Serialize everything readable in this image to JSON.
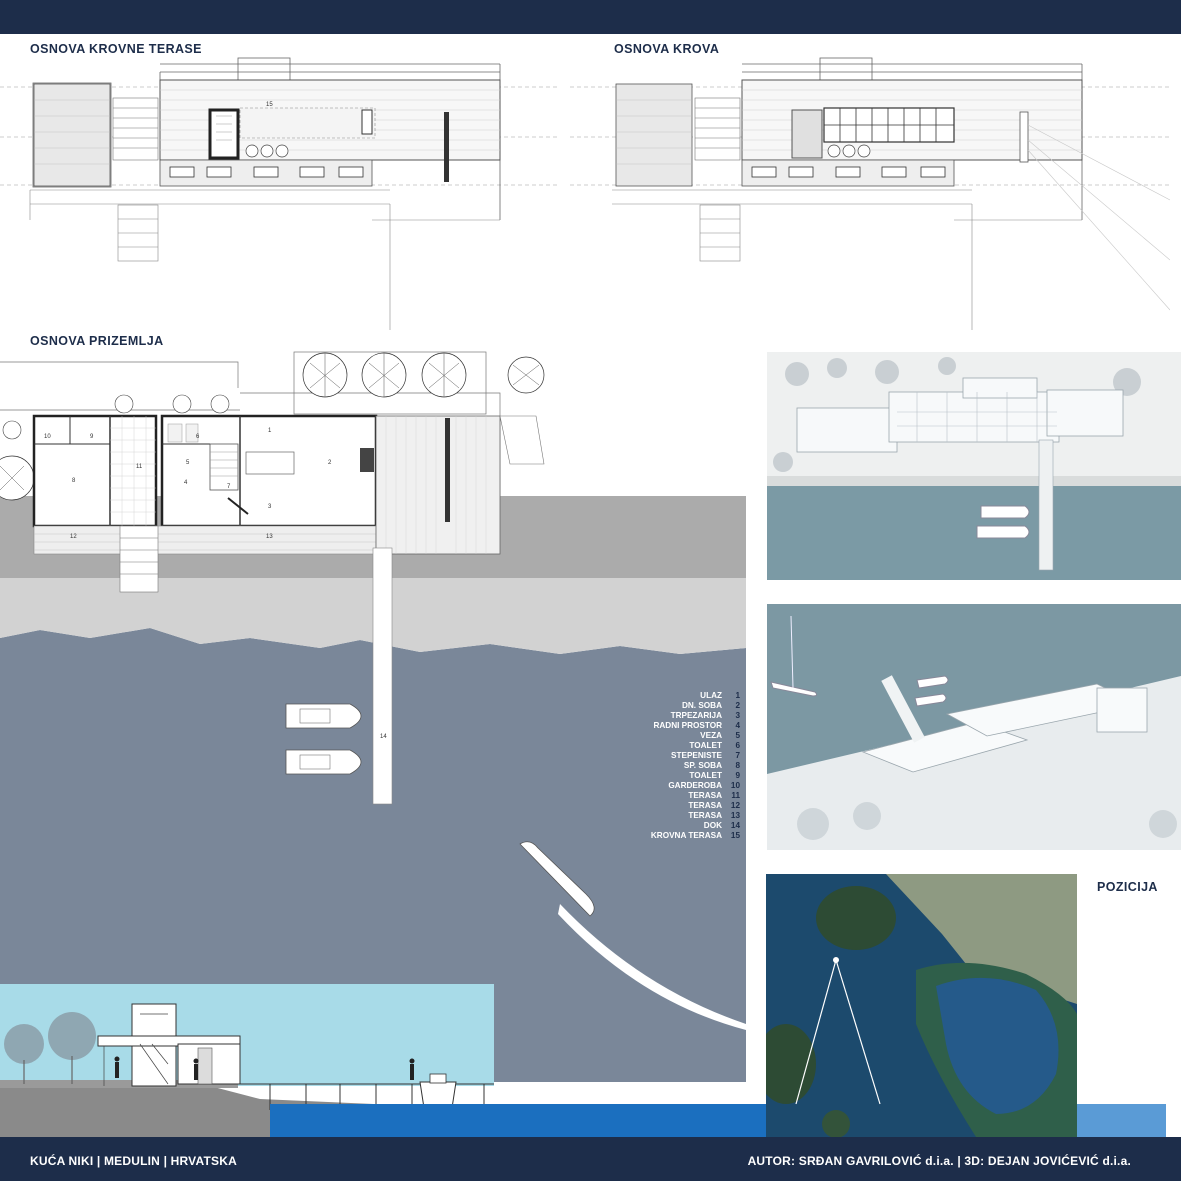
{
  "headings": {
    "roof_terrace_plan": "OSNOVA  KROVNE TERASE",
    "roof_plan": "OSNOVA  KROVA",
    "ground_floor_plan": "OSNOVA  PRIZEMLJA",
    "location": "POZICIJA"
  },
  "legend": [
    {
      "label": "ULAZ",
      "num": "1"
    },
    {
      "label": "DN. SOBA",
      "num": "2"
    },
    {
      "label": "TRPEZARIJA",
      "num": "3"
    },
    {
      "label": "RADNI PROSTOR",
      "num": "4"
    },
    {
      "label": "VEZA",
      "num": "5"
    },
    {
      "label": "TOALET",
      "num": "6"
    },
    {
      "label": "STEPENISTE",
      "num": "7"
    },
    {
      "label": "SP. SOBA",
      "num": "8"
    },
    {
      "label": "TOALET",
      "num": "9"
    },
    {
      "label": "GARDEROBA",
      "num": "10"
    },
    {
      "label": "TERASA",
      "num": "11"
    },
    {
      "label": "TERASA",
      "num": "12"
    },
    {
      "label": "TERASA",
      "num": "13"
    },
    {
      "label": "DOK",
      "num": "14"
    },
    {
      "label": "KROVNA TERASA",
      "num": "15"
    }
  ],
  "plan_labels": {
    "room_1": "1",
    "room_2": "2",
    "room_3": "3",
    "room_4": "4",
    "room_5": "5",
    "room_6": "6",
    "room_7": "7",
    "room_8": "8",
    "room_9": "9",
    "room_10": "10",
    "room_11": "11",
    "room_12": "12",
    "room_13": "13",
    "dock_14": "14",
    "roof_15": "15"
  },
  "footer": {
    "project": "KUĆA NIKI | MEDULIN | HRVATSKA",
    "author": "AUTOR: SRĐAN GAVRILOVIĆ d.i.a. | 3D: DEJAN JOVIĆEVIĆ d.i.a."
  },
  "colors": {
    "navy": "#1d2d4a",
    "sea_plan": "#7a8799",
    "shore": "#d2d2d2",
    "ground": "#ababab",
    "section_sky": "#a8dbe8",
    "sea_blue": "#1b6fbf",
    "render_sea": "#7b9aa5"
  }
}
